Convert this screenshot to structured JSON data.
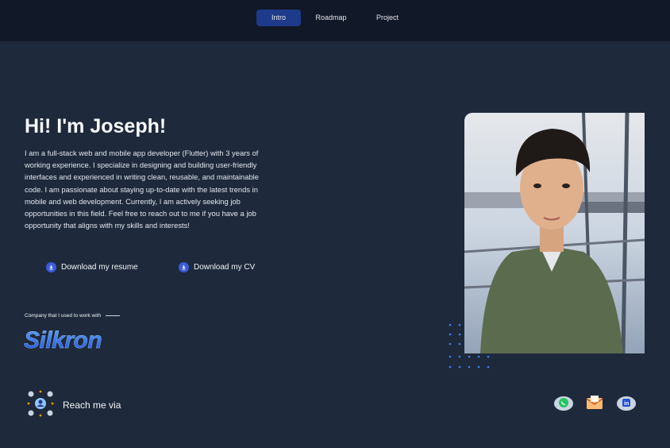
{
  "nav": {
    "items": [
      {
        "label": "Intro"
      },
      {
        "label": "Roadmap"
      },
      {
        "label": "Project"
      }
    ]
  },
  "hero": {
    "title": "Hi! I'm Joseph!",
    "description": "I am a full-stack web and mobile app developer (Flutter) with 3 years of working experience. I specialize in designing and building user-friendly interfaces and experienced in writing clean, reusable, and maintainable code. I am passionate about staying up-to-date with the latest trends in mobile and web development. Currently, I am actively seeking job opportunities in this field. Feel free to reach out to me if you have a job opportunity that aligns with my skills and interests!"
  },
  "downloads": {
    "resume_label": "Download my resume",
    "cv_label": "Download my CV"
  },
  "company": {
    "label": "Company that I used to work with",
    "logo_text": "Silkron"
  },
  "contact": {
    "label": "Reach me via",
    "icons": [
      "whatsapp-icon",
      "email-icon",
      "linkedin-icon"
    ]
  },
  "colors": {
    "background": "#1e293b",
    "topbar": "#111827",
    "nav_active": "#1e3a8a",
    "accent": "#3b5bdb",
    "logo": "#2563eb"
  }
}
